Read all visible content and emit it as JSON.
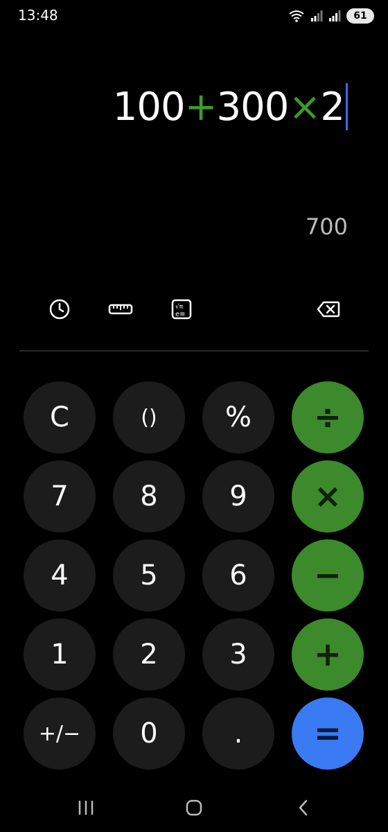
{
  "status": {
    "time": "13:48",
    "battery": "61"
  },
  "display": {
    "expression_parts": [
      "100",
      "+",
      "300",
      "×",
      "2"
    ],
    "result": "700"
  },
  "toolbar": {
    "icons": [
      "history-icon",
      "ruler-icon",
      "scientific-icon",
      "backspace-icon"
    ]
  },
  "keys": {
    "row1": [
      "C",
      "()",
      "%",
      "÷"
    ],
    "row2": [
      "7",
      "8",
      "9",
      "×"
    ],
    "row3": [
      "4",
      "5",
      "6",
      "−"
    ],
    "row4": [
      "1",
      "2",
      "3",
      "+"
    ],
    "row5": [
      "+/−",
      "0",
      ".",
      "="
    ]
  },
  "colors": {
    "operator_green": "#3d8a2c",
    "equals_blue": "#3a7bf3",
    "key_dark": "#1c1c1c",
    "cursor_blue": "#3b6de8"
  },
  "navbar": {
    "icons": [
      "recent-apps-icon",
      "home-icon",
      "back-icon"
    ]
  }
}
